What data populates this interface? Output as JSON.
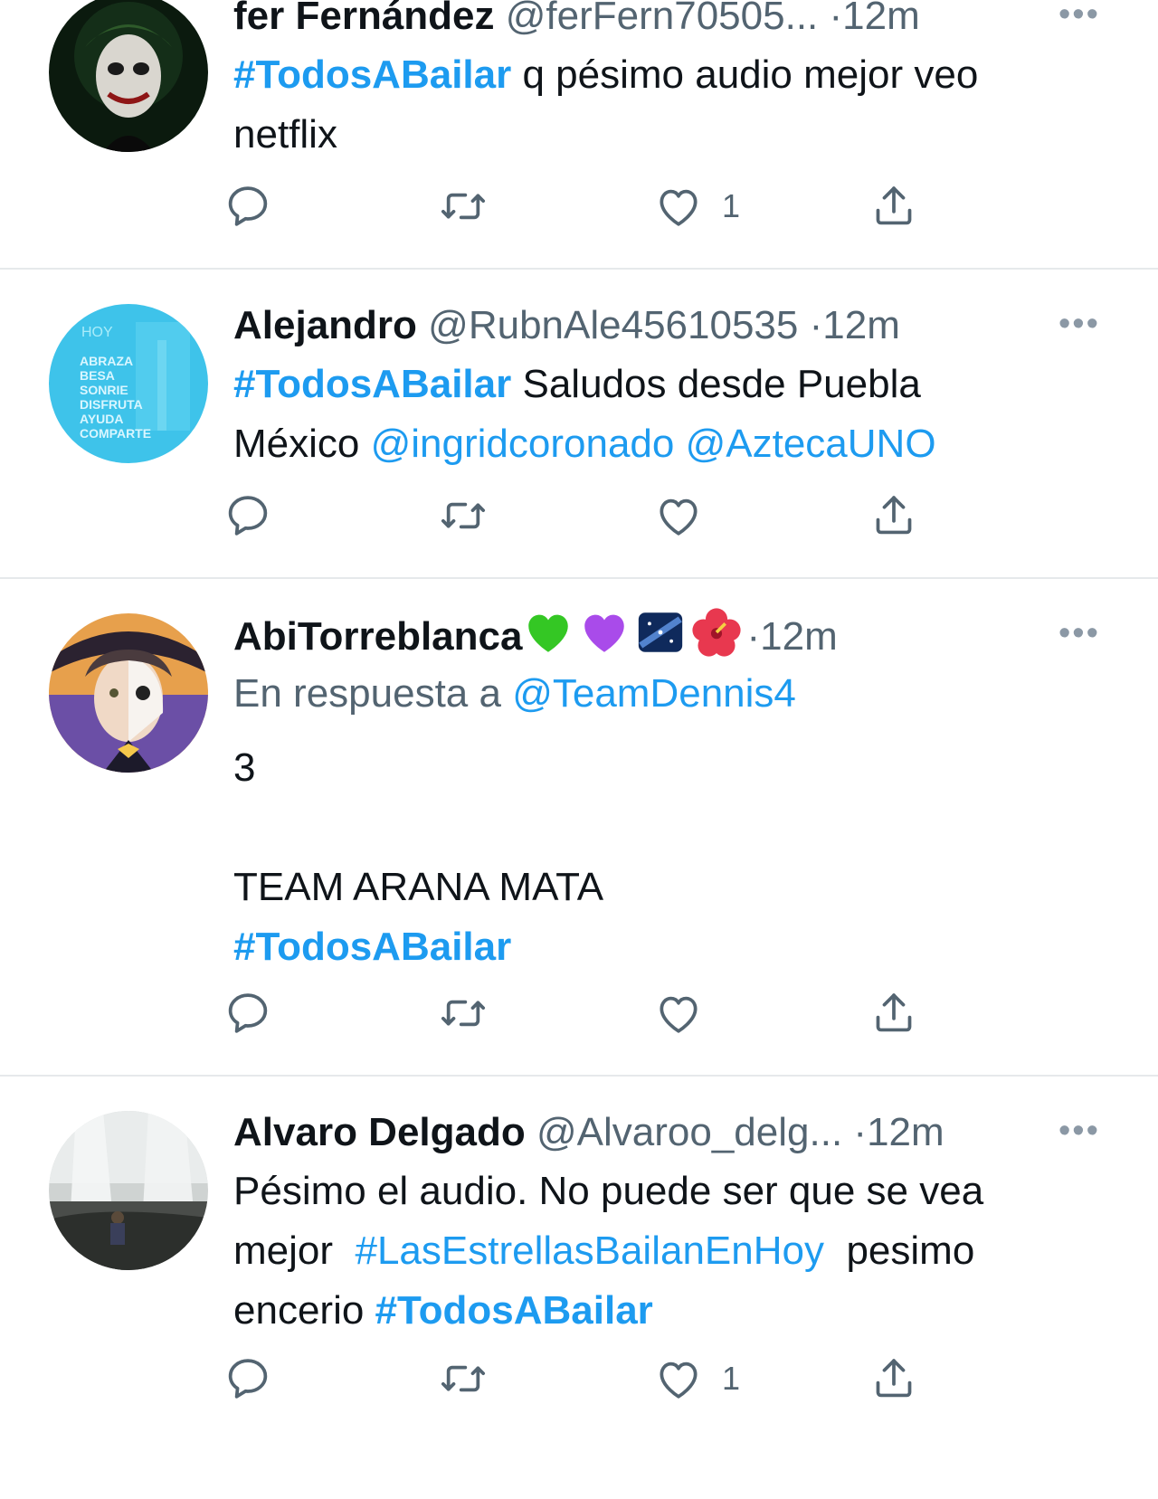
{
  "colors": {
    "accent": "#1d9bf0",
    "secondary_text": "#536471",
    "divider": "#e6e9eb"
  },
  "tweets": [
    {
      "name": "fer Fernández",
      "handle": "@ferFern70505...",
      "dot": "·",
      "time": "12m",
      "more": "•••",
      "text": {
        "tag": "#TodosABailar",
        "rest1": " q pésimo audio mejor veo",
        "rest2": "netflix"
      },
      "actions": {
        "like_count": "1"
      },
      "avatar_icon": "joker-avatar"
    },
    {
      "name": "Alejandro",
      "handle": "@RubnAle45610535",
      "dot": "·",
      "time": "12m",
      "more": "•••",
      "text": {
        "tag": "#TodosABailar",
        "rest1": " Saludos desde Puebla",
        "line2_plain": "México ",
        "mention1": "@ingridcoronado",
        "mention2": "@AztecaUNO"
      },
      "actions": {
        "like_count": ""
      },
      "avatar_text": {
        "top": "HOY",
        "l1": "ABRAZA",
        "l2": "BESA",
        "l3": "SONRIE",
        "l4": "DISFRUTA",
        "l5": "AYUDA",
        "l6": "COMPARTE"
      }
    },
    {
      "name": "AbiTorreblanca",
      "emojis": [
        "green-heart-icon",
        "purple-heart-icon",
        "milky-way-icon",
        "hibiscus-icon"
      ],
      "dot": "·",
      "time": "12m",
      "more": "•••",
      "reply_label": "En respuesta a ",
      "reply_handle": "@TeamDennis4",
      "text": {
        "line1": "3",
        "line3": "TEAM ARANA MATA",
        "tag": "#TodosABailar"
      },
      "actions": {
        "like_count": ""
      },
      "avatar_icon": "catrina-avatar"
    },
    {
      "name": "Alvaro Delgado",
      "handle": "@Alvaroo_delg...",
      "dot": "·",
      "time": "12m",
      "more": "•••",
      "text": {
        "line1": "Pésimo el audio. No puede ser que se vea",
        "line2_plain": "mejor ",
        "tag2": "#LasEstrellasBailanEnHoy",
        "line2_rest": " pesimo",
        "line3_plain": "encerio ",
        "tag": "#TodosABailar"
      },
      "actions": {
        "like_count": "1"
      },
      "avatar_icon": "waterfall-avatar"
    }
  ]
}
